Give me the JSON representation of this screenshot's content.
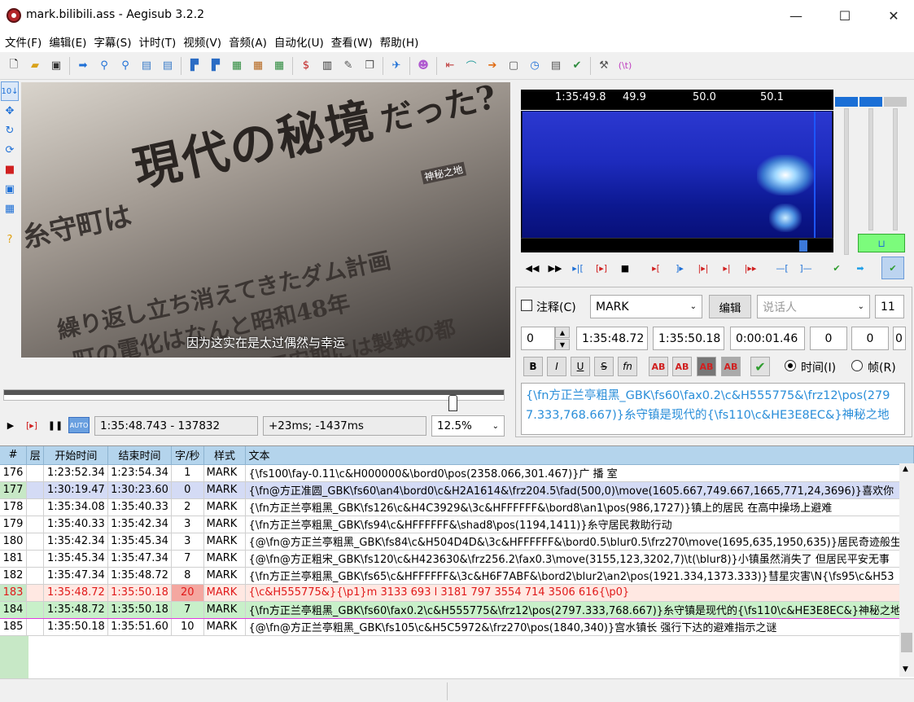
{
  "window": {
    "title": "mark.bilibili.ass - Aegisub 3.2.2",
    "minimize": "—",
    "maximize": "☐",
    "close": "✕"
  },
  "menu": [
    "文件(F)",
    "编辑(E)",
    "字幕(S)",
    "计时(T)",
    "视频(V)",
    "音频(A)",
    "自动化(U)",
    "查看(W)",
    "帮助(H)"
  ],
  "toolbar_icons": [
    "new-file-icon",
    "open-file-icon",
    "save-icon",
    "jump-icon",
    "zoom-in-icon",
    "zoom-out-icon",
    "video-open-icon",
    "video-close-icon",
    "keyframes-icon",
    "style-icon",
    "font-icon",
    "subtitles-icon",
    "detach-icon",
    "attach-icon",
    "translate-icon",
    "spell-icon",
    "character-icon",
    "assistant-icon",
    "shift-icon",
    "timer-icon",
    "resample-icon",
    "check-icon",
    "tools-icon",
    "tag-icon"
  ],
  "video": {
    "overlay_big": "現代の秘境",
    "overlay_big2": "だった?",
    "overlay_left": "糸守町は",
    "overlay_l2": "繰り返し立ち消えてきたダム計画",
    "overlay_l3": "町の電化はなんと昭和48年",
    "overlay_l4": "たたら場集落多数、平安期には製鉄の都",
    "overlay_tag": "神秘之地",
    "subtitle": "因为这实在是太过偶然与幸运"
  },
  "video_controls": {
    "time": "1:35:48.743 - 137832",
    "offset": "+23ms; -1437ms",
    "zoom": "12.5%"
  },
  "audio": {
    "ruler_ticks": [
      "1:35:49.8",
      "49.9",
      "50.0",
      "50.1"
    ]
  },
  "edit": {
    "comment_label": "注释(C)",
    "style": "MARK",
    "edit_button": "编辑",
    "actor_placeholder": "说话人",
    "effect_count": "11",
    "layer": "0",
    "start": "1:35:48.72",
    "end": "1:35:50.18",
    "duration": "0:00:01.46",
    "margin_l": "0",
    "margin_r": "0",
    "margin_v": "0",
    "time_label": "时间(I)",
    "frame_label": "帧(R)",
    "text": "{\\fn方正兰亭粗黑_GBK\\fs60\\fax0.2\\c&H555775&\\frz12\\pos(2797.333,768.667)}糸守镇是现代的{\\fs110\\c&HE3E8EC&}神秘之地"
  },
  "grid": {
    "headers": [
      "#",
      "层",
      "开始时间",
      "结束时间",
      "字/秒",
      "样式",
      "文本"
    ],
    "rows": [
      {
        "num": "176",
        "layer": "",
        "start": "1:23:52.34",
        "end": "1:23:54.34",
        "cps": "1",
        "style": "MARK",
        "text": "{\\fs100\\fay-0.11\\c&H000000&\\bord0\\pos(2358.066,301.467)}广 播 室"
      },
      {
        "num": "177",
        "layer": "",
        "start": "1:30:19.47",
        "end": "1:30:23.60",
        "cps": "0",
        "style": "MARK",
        "text": "{\\fn@方正准圆_GBK\\fs60\\an4\\bord0\\c&H2A1614&\\frz204.5\\fad(500,0)\\move(1605.667,749.667,1665,771,24,3696)}喜欢你"
      },
      {
        "num": "178",
        "layer": "",
        "start": "1:35:34.08",
        "end": "1:35:40.33",
        "cps": "2",
        "style": "MARK",
        "text": "{\\fn方正兰亭粗黑_GBK\\fs126\\c&H4C3929&\\3c&HFFFFFF&\\bord8\\an1\\pos(986,1727)}镇上的居民 在高中操场上避难"
      },
      {
        "num": "179",
        "layer": "",
        "start": "1:35:40.33",
        "end": "1:35:42.34",
        "cps": "3",
        "style": "MARK",
        "text": "{\\fn方正兰亭粗黑_GBK\\fs94\\c&HFFFFFF&\\shad8\\pos(1194,1411)}糸守居民救助行动"
      },
      {
        "num": "180",
        "layer": "",
        "start": "1:35:42.34",
        "end": "1:35:45.34",
        "cps": "3",
        "style": "MARK",
        "text": "{@\\fn@方正兰亭粗黑_GBK\\fs84\\c&H504D4D&\\3c&HFFFFFF&\\bord0.5\\blur0.5\\frz270\\move(1695,635,1950,635)}居民奇迹般生还"
      },
      {
        "num": "181",
        "layer": "",
        "start": "1:35:45.34",
        "end": "1:35:47.34",
        "cps": "7",
        "style": "MARK",
        "text": "{@\\fn@方正粗宋_GBK\\fs120\\c&H423630&\\frz256.2\\fax0.3\\move(3155,123,3202,7)\\t(\\blur8)}小镇虽然消失了 但居民平安无事"
      },
      {
        "num": "182",
        "layer": "",
        "start": "1:35:47.34",
        "end": "1:35:48.72",
        "cps": "8",
        "style": "MARK",
        "text": "{\\fn方正兰亭粗黑_GBK\\fs65\\c&HFFFFFF&\\3c&H6F7ABF&\\bord2\\blur2\\an2\\pos(1921.334,1373.333)}彗星灾害\\N{\\fs95\\c&H53"
      },
      {
        "num": "183",
        "layer": "",
        "start": "1:35:48.72",
        "end": "1:35:50.18",
        "cps": "20",
        "style": "MARK",
        "text": "{\\c&H555775&}{\\p1}m 3133 693 l 3181 797 3554 714 3506 616{\\p0}"
      },
      {
        "num": "184",
        "layer": "",
        "start": "1:35:48.72",
        "end": "1:35:50.18",
        "cps": "7",
        "style": "MARK",
        "text": "{\\fn方正兰亭粗黑_GBK\\fs60\\fax0.2\\c&H555775&\\frz12\\pos(2797.333,768.667)}糸守镇是现代的{\\fs110\\c&HE3E8EC&}神秘之地"
      },
      {
        "num": "185",
        "layer": "",
        "start": "1:35:50.18",
        "end": "1:35:51.60",
        "cps": "10",
        "style": "MARK",
        "text": "{@\\fn@方正兰亭粗黑_GBK\\fs105\\c&H5C5972&\\frz270\\pos(1840,340)}宫水镇长 强行下达的避难指示之谜"
      }
    ]
  },
  "colors": {
    "grid_header": "#b4d4ec",
    "selected_row": "#d4dbf5",
    "active_row": "#c8f0c9",
    "collision_row": "#ffe8e2",
    "tag_blue": "#2a8ed9"
  }
}
